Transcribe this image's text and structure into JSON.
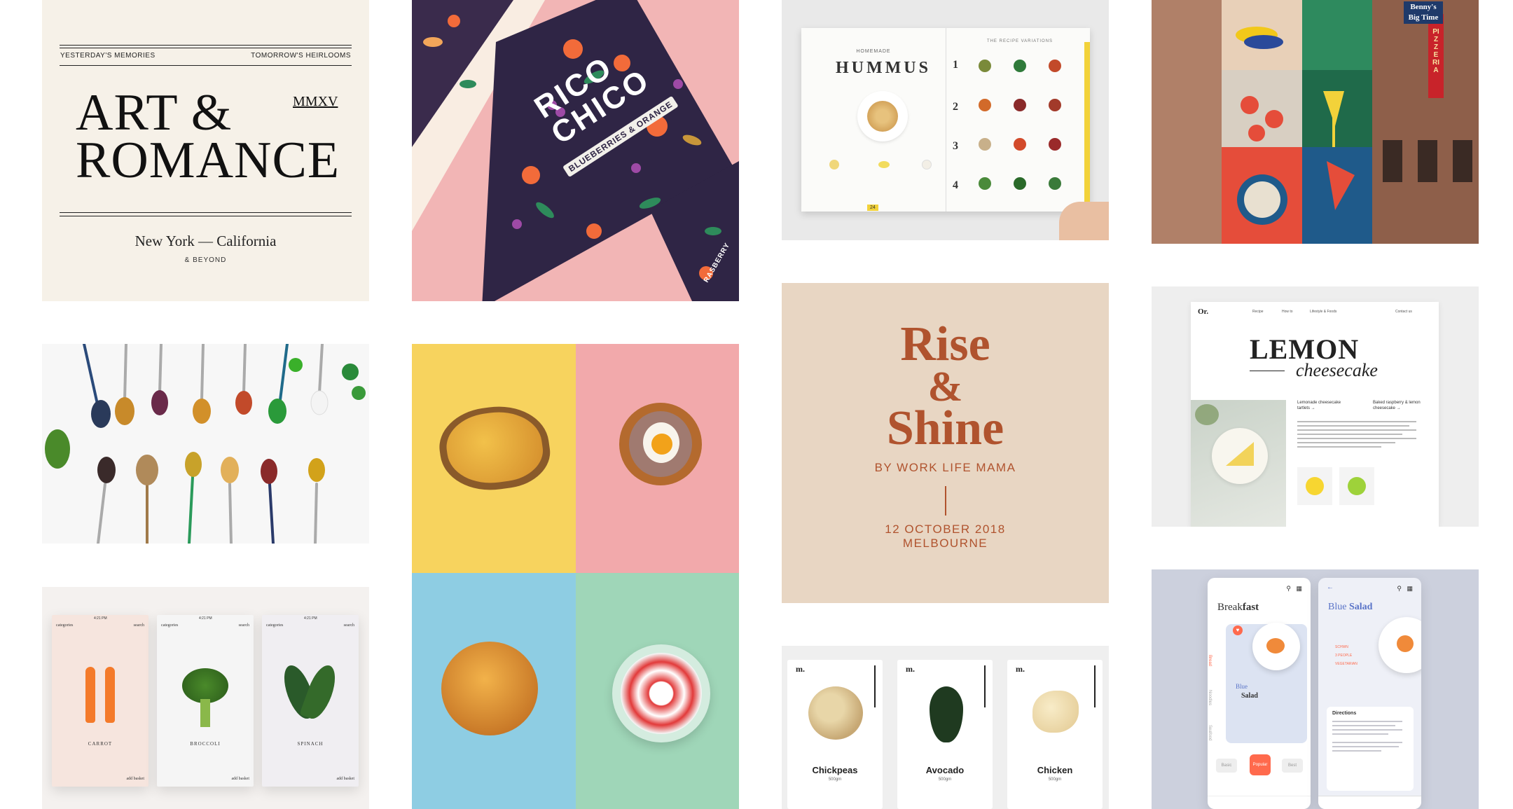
{
  "art": {
    "left_header": "YESTERDAY'S MEMORIES",
    "right_header": "TOMORROW'S HEIRLOOMS",
    "title_line1": "ART &",
    "title_line2": "ROMANCE",
    "year": "MMXV",
    "subtitle": "New York — California",
    "footer": "& BEYOND"
  },
  "rico": {
    "title": "RICO CHICO",
    "flavor": "BLUEBERRIES & ORANGE",
    "side_label": "RASBERRY"
  },
  "hummus": {
    "kicker": "HOMEMADE",
    "title": "HUMMUS",
    "section": "THE RECIPE VARIATIONS",
    "steps": [
      "1",
      "2",
      "3",
      "4"
    ],
    "page_number": "24"
  },
  "mural": {
    "sign1": "Benny's",
    "sign2": "Big Time",
    "sign_vertical": "PIZZERIA"
  },
  "lemon": {
    "logo": "Or.",
    "title": "LEMON",
    "subtitle": "cheesecake",
    "nav": [
      "Recipe",
      "How to",
      "Lifestyle & Foods",
      "Contact us"
    ],
    "link1": "Lemonade cheesecake tartlets →",
    "link2": "Baked raspberry & lemon cheesecake →"
  },
  "rise": {
    "title1": "Rise",
    "amp": "&",
    "title2": "Shine",
    "byline": "BY WORK LIFE MAMA",
    "date": "12 OCTOBER 2018",
    "place": "MELBOURNE"
  },
  "veg": {
    "status_time": "4:21 PM",
    "categories_label": "categories",
    "search_label": "search",
    "add_label": "add basket",
    "items": [
      "CARROT",
      "BROCCOLI",
      "SPINACH"
    ]
  },
  "cards": {
    "logo": "m.",
    "weight": "500gm",
    "items": [
      "Chickpeas",
      "Avocado",
      "Chicken"
    ]
  },
  "breakfast": {
    "title_light": "Break",
    "title_bold": "fast",
    "tabs": [
      "Bread",
      "Noodles",
      "Seafood"
    ],
    "dish_light": "Blue",
    "dish_bold": "Salad",
    "detail_title_light": "Blue",
    "detail_title_bold": "Salad",
    "detail_list": [
      "SCHWN",
      "3 PEOPLE",
      "VEGETARIAN"
    ],
    "directions": "Directions",
    "buttons": [
      "Basic",
      "Popular",
      "Best"
    ]
  },
  "colors": {
    "rise_bg": "#e8d6c3",
    "rise_accent": "#b0532e",
    "rico_bg": "#33294a",
    "rico_pink": "#f2b5b5",
    "breakfast_accent": "#ff6a4d",
    "blue_link": "#5a74c8"
  }
}
